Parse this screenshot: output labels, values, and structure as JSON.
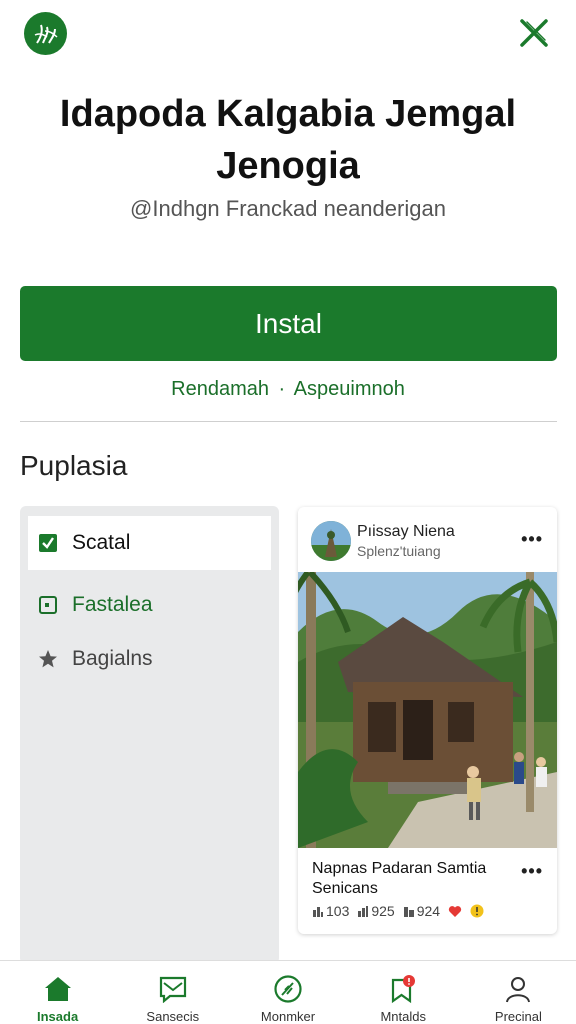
{
  "header": {
    "logo_icon": "leaf-logo-icon",
    "close_icon": "close-icon"
  },
  "app": {
    "title": "Idapoda Kalgabia Jemgal Jenogia",
    "subtitle": "@Indhgn Franckad neanderigan"
  },
  "install_button": {
    "label": "Instal"
  },
  "meta_links": {
    "left": "Rendamah",
    "separator": "·",
    "right": "Aspeuimnoh"
  },
  "section": {
    "title": "Puplasia"
  },
  "side_menu": {
    "items": [
      {
        "label": "Scatal",
        "icon": "checkbox-icon",
        "active": true
      },
      {
        "label": "Fastalea",
        "icon": "square-dot-icon"
      },
      {
        "label": "Bagialns",
        "icon": "star-icon"
      }
    ]
  },
  "post_card": {
    "author_name": "Pıissay Niena",
    "author_handle": "Splenz'tuiang",
    "more_label": "•••",
    "caption": "Napnas Padaran Samtia Senicans",
    "stats": {
      "stat1": "103",
      "stat2": "925",
      "stat3": "924"
    }
  },
  "bottom_nav": {
    "items": [
      {
        "label": "Insada",
        "icon": "home-icon",
        "active": true
      },
      {
        "label": "Sansecis",
        "icon": "message-icon"
      },
      {
        "label": "Monmker",
        "icon": "feather-icon"
      },
      {
        "label": "Mntalds",
        "icon": "notification-bookmark-icon"
      },
      {
        "label": "Precinal",
        "icon": "profile-icon"
      }
    ]
  },
  "colors": {
    "accent": "#1b7a2c",
    "accent_text": "#1b6f2a",
    "panel_bg": "#e9eaeb",
    "heart": "#e53935",
    "badge": "#f2c21b"
  }
}
